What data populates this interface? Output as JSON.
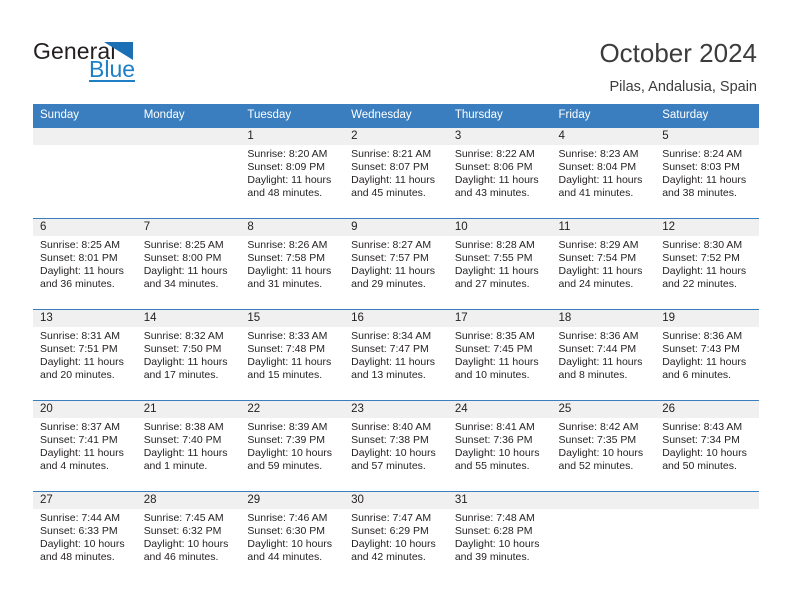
{
  "brand": {
    "name_part1": "General",
    "name_part2": "Blue",
    "triangle_color": "#1b6fb5",
    "blue_color": "#1f7fc4"
  },
  "header": {
    "title": "October 2024",
    "subtitle": "Pilas, Andalusia, Spain",
    "accent_color": "#3a7ebf"
  },
  "calendar": {
    "weekday_headers": [
      "Sunday",
      "Monday",
      "Tuesday",
      "Wednesday",
      "Thursday",
      "Friday",
      "Saturday"
    ],
    "labels": {
      "sunrise": "Sunrise:",
      "sunset": "Sunset:",
      "daylight": "Daylight:"
    },
    "weeks": [
      [
        {
          "day": "",
          "empty": true
        },
        {
          "day": "",
          "empty": true
        },
        {
          "day": "1",
          "sunrise": "Sunrise: 8:20 AM",
          "sunset": "Sunset: 8:09 PM",
          "daylight_line1": "Daylight: 11 hours",
          "daylight_line2": "and 48 minutes."
        },
        {
          "day": "2",
          "sunrise": "Sunrise: 8:21 AM",
          "sunset": "Sunset: 8:07 PM",
          "daylight_line1": "Daylight: 11 hours",
          "daylight_line2": "and 45 minutes."
        },
        {
          "day": "3",
          "sunrise": "Sunrise: 8:22 AM",
          "sunset": "Sunset: 8:06 PM",
          "daylight_line1": "Daylight: 11 hours",
          "daylight_line2": "and 43 minutes."
        },
        {
          "day": "4",
          "sunrise": "Sunrise: 8:23 AM",
          "sunset": "Sunset: 8:04 PM",
          "daylight_line1": "Daylight: 11 hours",
          "daylight_line2": "and 41 minutes."
        },
        {
          "day": "5",
          "sunrise": "Sunrise: 8:24 AM",
          "sunset": "Sunset: 8:03 PM",
          "daylight_line1": "Daylight: 11 hours",
          "daylight_line2": "and 38 minutes."
        }
      ],
      [
        {
          "day": "6",
          "sunrise": "Sunrise: 8:25 AM",
          "sunset": "Sunset: 8:01 PM",
          "daylight_line1": "Daylight: 11 hours",
          "daylight_line2": "and 36 minutes."
        },
        {
          "day": "7",
          "sunrise": "Sunrise: 8:25 AM",
          "sunset": "Sunset: 8:00 PM",
          "daylight_line1": "Daylight: 11 hours",
          "daylight_line2": "and 34 minutes."
        },
        {
          "day": "8",
          "sunrise": "Sunrise: 8:26 AM",
          "sunset": "Sunset: 7:58 PM",
          "daylight_line1": "Daylight: 11 hours",
          "daylight_line2": "and 31 minutes."
        },
        {
          "day": "9",
          "sunrise": "Sunrise: 8:27 AM",
          "sunset": "Sunset: 7:57 PM",
          "daylight_line1": "Daylight: 11 hours",
          "daylight_line2": "and 29 minutes."
        },
        {
          "day": "10",
          "sunrise": "Sunrise: 8:28 AM",
          "sunset": "Sunset: 7:55 PM",
          "daylight_line1": "Daylight: 11 hours",
          "daylight_line2": "and 27 minutes."
        },
        {
          "day": "11",
          "sunrise": "Sunrise: 8:29 AM",
          "sunset": "Sunset: 7:54 PM",
          "daylight_line1": "Daylight: 11 hours",
          "daylight_line2": "and 24 minutes."
        },
        {
          "day": "12",
          "sunrise": "Sunrise: 8:30 AM",
          "sunset": "Sunset: 7:52 PM",
          "daylight_line1": "Daylight: 11 hours",
          "daylight_line2": "and 22 minutes."
        }
      ],
      [
        {
          "day": "13",
          "sunrise": "Sunrise: 8:31 AM",
          "sunset": "Sunset: 7:51 PM",
          "daylight_line1": "Daylight: 11 hours",
          "daylight_line2": "and 20 minutes."
        },
        {
          "day": "14",
          "sunrise": "Sunrise: 8:32 AM",
          "sunset": "Sunset: 7:50 PM",
          "daylight_line1": "Daylight: 11 hours",
          "daylight_line2": "and 17 minutes."
        },
        {
          "day": "15",
          "sunrise": "Sunrise: 8:33 AM",
          "sunset": "Sunset: 7:48 PM",
          "daylight_line1": "Daylight: 11 hours",
          "daylight_line2": "and 15 minutes."
        },
        {
          "day": "16",
          "sunrise": "Sunrise: 8:34 AM",
          "sunset": "Sunset: 7:47 PM",
          "daylight_line1": "Daylight: 11 hours",
          "daylight_line2": "and 13 minutes."
        },
        {
          "day": "17",
          "sunrise": "Sunrise: 8:35 AM",
          "sunset": "Sunset: 7:45 PM",
          "daylight_line1": "Daylight: 11 hours",
          "daylight_line2": "and 10 minutes."
        },
        {
          "day": "18",
          "sunrise": "Sunrise: 8:36 AM",
          "sunset": "Sunset: 7:44 PM",
          "daylight_line1": "Daylight: 11 hours",
          "daylight_line2": "and 8 minutes."
        },
        {
          "day": "19",
          "sunrise": "Sunrise: 8:36 AM",
          "sunset": "Sunset: 7:43 PM",
          "daylight_line1": "Daylight: 11 hours",
          "daylight_line2": "and 6 minutes."
        }
      ],
      [
        {
          "day": "20",
          "sunrise": "Sunrise: 8:37 AM",
          "sunset": "Sunset: 7:41 PM",
          "daylight_line1": "Daylight: 11 hours",
          "daylight_line2": "and 4 minutes."
        },
        {
          "day": "21",
          "sunrise": "Sunrise: 8:38 AM",
          "sunset": "Sunset: 7:40 PM",
          "daylight_line1": "Daylight: 11 hours",
          "daylight_line2": "and 1 minute."
        },
        {
          "day": "22",
          "sunrise": "Sunrise: 8:39 AM",
          "sunset": "Sunset: 7:39 PM",
          "daylight_line1": "Daylight: 10 hours",
          "daylight_line2": "and 59 minutes."
        },
        {
          "day": "23",
          "sunrise": "Sunrise: 8:40 AM",
          "sunset": "Sunset: 7:38 PM",
          "daylight_line1": "Daylight: 10 hours",
          "daylight_line2": "and 57 minutes."
        },
        {
          "day": "24",
          "sunrise": "Sunrise: 8:41 AM",
          "sunset": "Sunset: 7:36 PM",
          "daylight_line1": "Daylight: 10 hours",
          "daylight_line2": "and 55 minutes."
        },
        {
          "day": "25",
          "sunrise": "Sunrise: 8:42 AM",
          "sunset": "Sunset: 7:35 PM",
          "daylight_line1": "Daylight: 10 hours",
          "daylight_line2": "and 52 minutes."
        },
        {
          "day": "26",
          "sunrise": "Sunrise: 8:43 AM",
          "sunset": "Sunset: 7:34 PM",
          "daylight_line1": "Daylight: 10 hours",
          "daylight_line2": "and 50 minutes."
        }
      ],
      [
        {
          "day": "27",
          "sunrise": "Sunrise: 7:44 AM",
          "sunset": "Sunset: 6:33 PM",
          "daylight_line1": "Daylight: 10 hours",
          "daylight_line2": "and 48 minutes."
        },
        {
          "day": "28",
          "sunrise": "Sunrise: 7:45 AM",
          "sunset": "Sunset: 6:32 PM",
          "daylight_line1": "Daylight: 10 hours",
          "daylight_line2": "and 46 minutes."
        },
        {
          "day": "29",
          "sunrise": "Sunrise: 7:46 AM",
          "sunset": "Sunset: 6:30 PM",
          "daylight_line1": "Daylight: 10 hours",
          "daylight_line2": "and 44 minutes."
        },
        {
          "day": "30",
          "sunrise": "Sunrise: 7:47 AM",
          "sunset": "Sunset: 6:29 PM",
          "daylight_line1": "Daylight: 10 hours",
          "daylight_line2": "and 42 minutes."
        },
        {
          "day": "31",
          "sunrise": "Sunrise: 7:48 AM",
          "sunset": "Sunset: 6:28 PM",
          "daylight_line1": "Daylight: 10 hours",
          "daylight_line2": "and 39 minutes."
        },
        {
          "day": "",
          "empty": true
        },
        {
          "day": "",
          "empty": true
        }
      ]
    ]
  }
}
